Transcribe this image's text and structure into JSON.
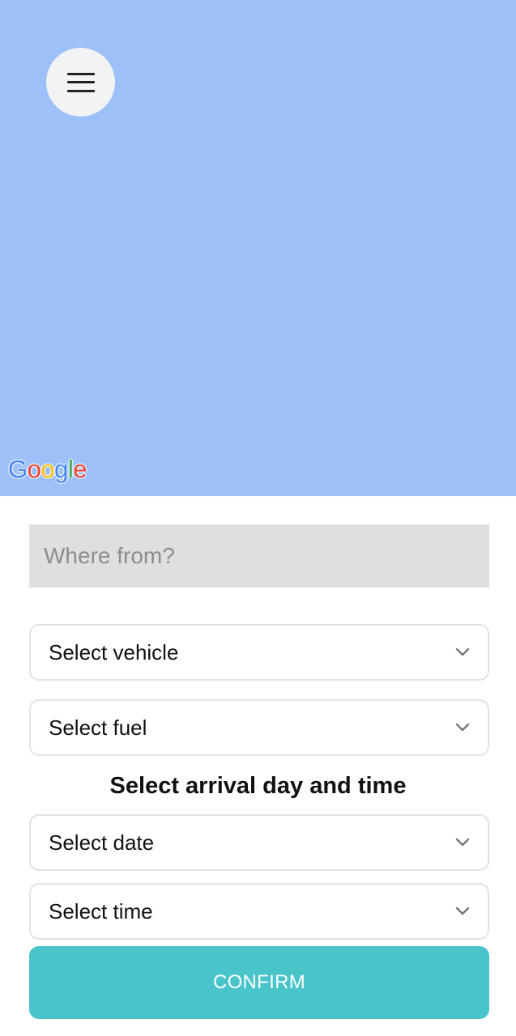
{
  "map": {
    "logo_letters": [
      "G",
      "o",
      "o",
      "g",
      "l",
      "e"
    ],
    "background_color": "#9dc0f9"
  },
  "menu": {
    "icon": "hamburger-menu-icon"
  },
  "search": {
    "placeholder": "Where from?",
    "value": ""
  },
  "selects": {
    "vehicle": "Select vehicle",
    "fuel": "Select fuel",
    "date": "Select date",
    "time": "Select time"
  },
  "arrival": {
    "title": "Select arrival day and time"
  },
  "confirm": {
    "label": "CONFIRM",
    "color": "#48c4ca"
  }
}
